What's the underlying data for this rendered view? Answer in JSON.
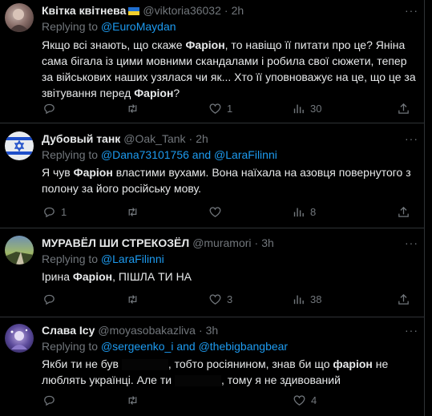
{
  "tweets": [
    {
      "name": "Квітка квітнева",
      "handle": "@viktoria36032",
      "time": "2h",
      "reply_prefix": "Replying to",
      "reply_to": "@EuroMaydan",
      "text_parts": [
        "Якщо всі знають, що скаже ",
        "Фаріон",
        ", то навіщо її питати про це? Яніна сама бігала із цими мовними скандалами і робила свої сюжети, тепер за військових наших узялася чи як... Хто її уповноважує на це, що це за звітування перед ",
        "Фаріон",
        "?"
      ],
      "replies": "",
      "retweets": "",
      "likes": "1",
      "views": "30"
    },
    {
      "name": "Дубовый танк",
      "handle": "@Oak_Tank",
      "time": "2h",
      "reply_prefix": "Replying to",
      "reply_to": "@Dana73101756 and @LaraFilinni",
      "text_parts": [
        "Я чув ",
        "Фаріон",
        " властими вухами. Вона наїхала на азовця повернутого з полону за його російську мову."
      ],
      "replies": "1",
      "retweets": "",
      "likes": "",
      "views": "8"
    },
    {
      "name": "МУРАВЁЛ ШИ СТРЕКОЗЁЛ",
      "handle": "@muramori",
      "time": "3h",
      "reply_prefix": "Replying to",
      "reply_to": "@LaraFilinni",
      "text_parts": [
        "Ірина ",
        "Фаріон",
        ", ПІШЛА ТИ НА"
      ],
      "replies": "",
      "retweets": "",
      "likes": "3",
      "views": "38"
    },
    {
      "name": "Слава Ісу",
      "handle": "@moyasobakazliva",
      "time": "3h",
      "reply_prefix": "Replying to",
      "reply_to": "@sergeenko_i and @thebigbangbear",
      "text_parts": [
        "Якби ти не був ",
        ", тобто росіянином, знав би що ",
        "фаріон",
        " не люблять українці. Але ти ",
        ", тому я не здивований"
      ],
      "replies": "",
      "retweets": "",
      "likes": "4",
      "views": ""
    }
  ],
  "more_label": "···",
  "separator": "·",
  "colors": {
    "accent": "#1d9bf0",
    "muted": "#71767b",
    "text": "#e7e9ea",
    "background": "#000000"
  }
}
